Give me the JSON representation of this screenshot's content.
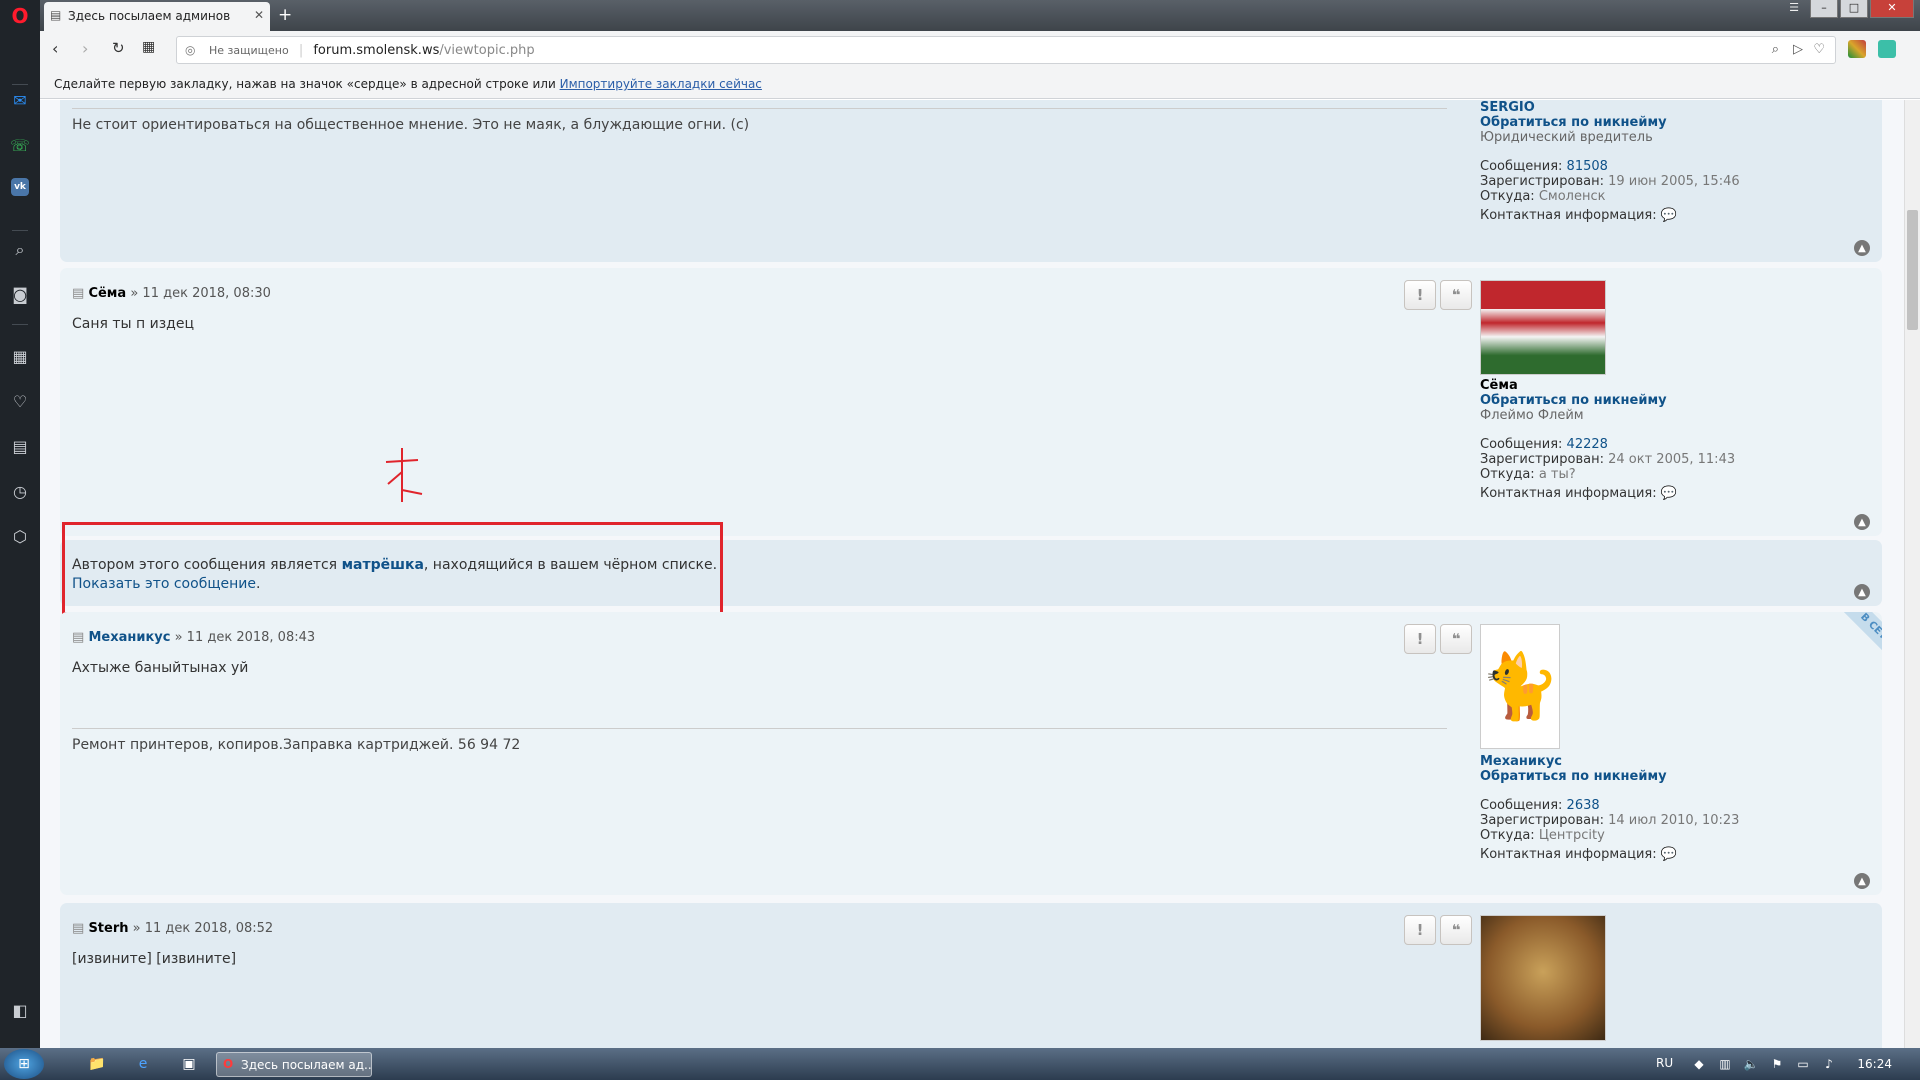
{
  "browser": {
    "tab_title": "Здесь посылаем админов",
    "new_tab": "+",
    "security": "Не защищено",
    "url_host": "forum.smolensk.ws",
    "url_path": "/viewtopic.php",
    "bookmark_hint": "Сделайте первую закладку, нажав на значок «сердце» в адресной строке или",
    "bookmark_link": "Импортируйте закладки сейчас"
  },
  "posts": [
    {
      "body": "Не стоит ориентироваться на общественное мнение. Это не маяк, а блуждающие огни. (с)",
      "profile": {
        "name": "SERGIO",
        "nick_link": "Обратиться по никнейму",
        "rank": "Юридический вредитель",
        "messages_label": "Сообщения:",
        "messages": "81508",
        "registered_label": "Зарегистрирован:",
        "registered": "19 июн 2005, 15:46",
        "from_label": "Откуда:",
        "from": "Смоленск",
        "contact_label": "Контактная информация:"
      }
    },
    {
      "author": "Сёма",
      "date": "» 11 дек 2018, 08:30",
      "body": "Саня ты п издец",
      "profile": {
        "name": "Сёма",
        "nick_link": "Обратиться по никнейму",
        "rank": "Флеймо Флейм",
        "messages_label": "Сообщения:",
        "messages": "42228",
        "registered_label": "Зарегистрирован:",
        "registered": "24 окт 2005, 11:43",
        "from_label": "Откуда:",
        "from": "а ты?",
        "contact_label": "Контактная информация:"
      }
    },
    {
      "author": "Механикус",
      "date": "» 11 дек 2018, 08:43",
      "body": "Ахтыже баныйтынах уй",
      "signature": "Ремонт принтеров, копиров.Заправка картриджей. 56 94 72",
      "online_badge": "В СЕТИ",
      "profile": {
        "name": "Механикус",
        "nick_link": "Обратиться по никнейму",
        "messages_label": "Сообщения:",
        "messages": "2638",
        "registered_label": "Зарегистрирован:",
        "registered": "14 июл 2010, 10:23",
        "from_label": "Откуда:",
        "from": "Центрсity",
        "contact_label": "Контактная информация:"
      }
    },
    {
      "author": "Sterh",
      "date": "» 11 дек 2018, 08:52",
      "body": "[извините] [извините]"
    }
  ],
  "ignored": {
    "prefix": "Автором этого сообщения является",
    "user": "матрёшка",
    "suffix": ", находящийся в вашем чёрном списке.",
    "show_link": "Показать это сообщение",
    "dot": "."
  },
  "buttons": {
    "report": "!",
    "quote": "❝"
  },
  "taskbar": {
    "opera_item": "Здесь посылаем ад...",
    "lang": "RU",
    "clock": "16:24"
  },
  "colors": {
    "highlight": "#e0242c",
    "post_bg": "#e1ebf2",
    "link": "#105289"
  }
}
